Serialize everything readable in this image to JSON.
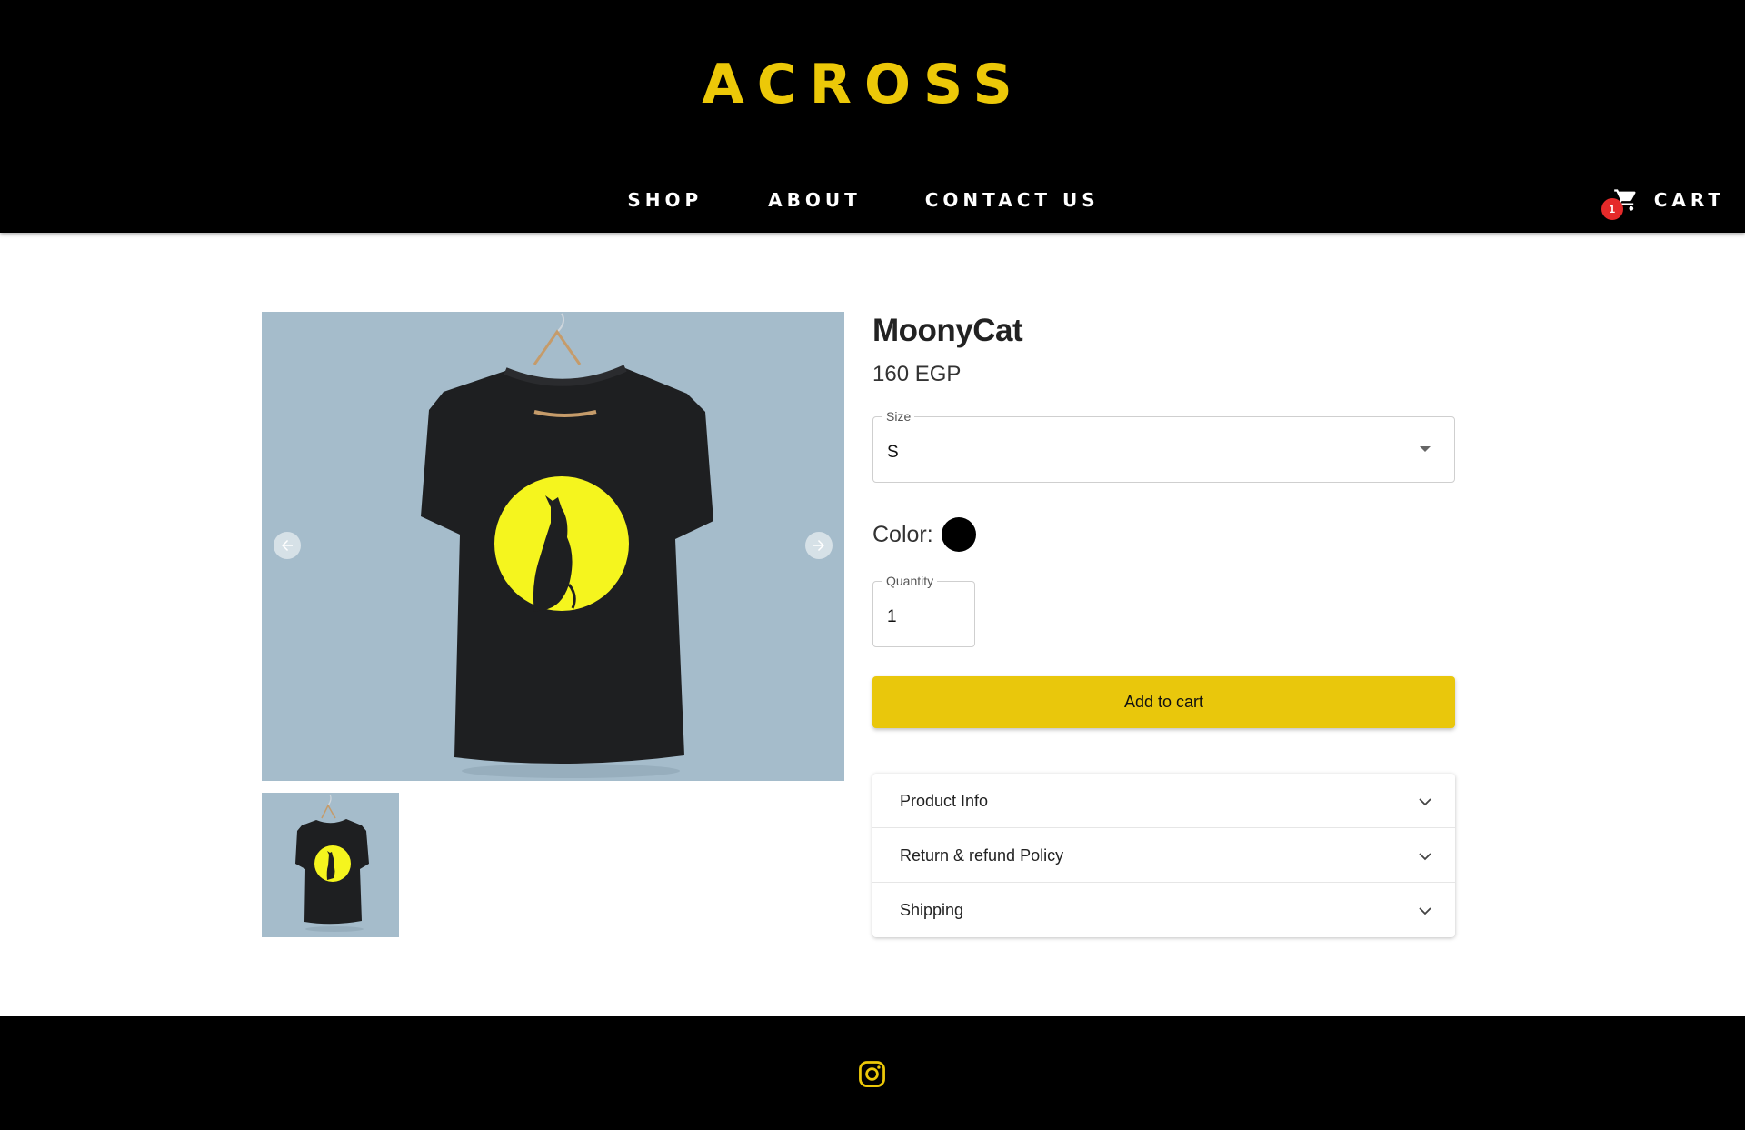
{
  "header": {
    "logo_text": "ACROSS",
    "nav": [
      {
        "label": "SHOP"
      },
      {
        "label": "ABOUT"
      },
      {
        "label": "CONTACT US"
      }
    ],
    "cart": {
      "label": "CART",
      "count": "1"
    }
  },
  "product": {
    "title": "MoonyCat",
    "price": "160 EGP",
    "size": {
      "legend": "Size",
      "value": "S"
    },
    "color": {
      "label": "Color:",
      "swatch": "#000000"
    },
    "quantity": {
      "legend": "Quantity",
      "value": "1"
    },
    "add_to_cart_label": "Add to cart",
    "sections": [
      {
        "label": "Product Info"
      },
      {
        "label": "Return & refund Policy"
      },
      {
        "label": "Shipping"
      }
    ]
  },
  "gallery": {
    "background_color": "#a5bccb",
    "shirt_color": "#1e1f21",
    "print_color": "#f5f51e"
  },
  "footer": {
    "social_icon": "instagram-icon"
  },
  "colors": {
    "brand_yellow": "#ecc808",
    "button_yellow": "#e9c70c",
    "badge_red": "#e52a2a"
  }
}
